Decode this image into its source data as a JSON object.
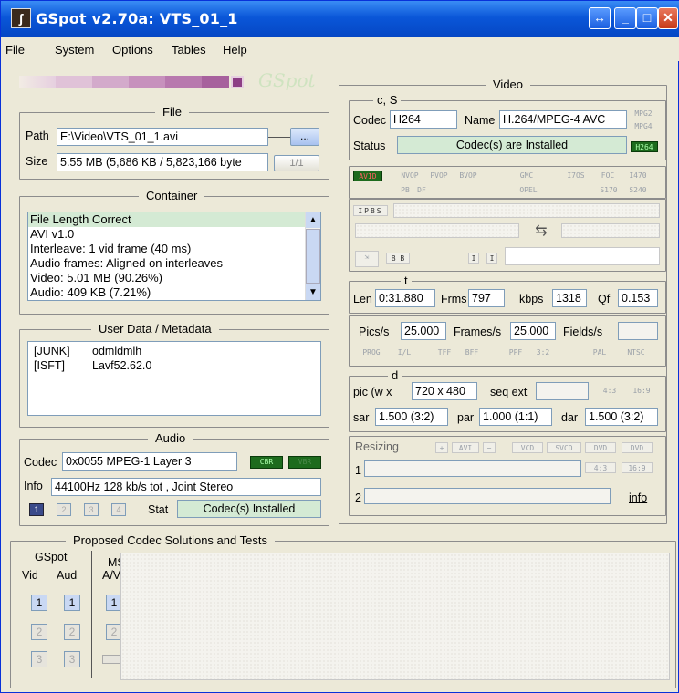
{
  "window": {
    "title": "GSpot v2.70a: VTS_01_1"
  },
  "menu": [
    "File",
    "System",
    "Options",
    "Tables",
    "Help"
  ],
  "file": {
    "group_title": "File",
    "path_label": "Path",
    "path_value": "E:\\Video\\VTS_01_1.avi",
    "browse_label": "...",
    "size_label": "Size",
    "size_value": "5.55 MB (5,686 KB / 5,823,166 byte",
    "counter": "1/1"
  },
  "container": {
    "group_title": "Container",
    "items": [
      "File Length Correct",
      "AVI v1.0",
      "Interleave: 1 vid frame (40 ms)",
      "Audio frames: Aligned on interleaves",
      "Video: 5.01 MB (90.26%)",
      "Audio: 409 KB (7.21%)"
    ]
  },
  "user_data": {
    "group_title": "User Data / Metadata",
    "rows": [
      {
        "key": "[JUNK]",
        "value": "odmldmlh"
      },
      {
        "key": "[ISFT]",
        "value": "Lavf52.62.0"
      }
    ]
  },
  "audio": {
    "group_title": "Audio",
    "codec_label": "Codec",
    "codec_value": "0x0055 MPEG-1 Layer 3",
    "cbr": "CBR",
    "vbr": "VBR",
    "info_label": "Info",
    "info_value": "44100Hz  128 kb/s tot , Joint Stereo",
    "streams": [
      "1",
      "2",
      "3",
      "4"
    ],
    "stat_label": "Stat",
    "stat_value": "Codec(s) Installed"
  },
  "video": {
    "group_title": "Video",
    "cs_title": "c, S",
    "codec_label": "Codec",
    "codec_value": "H264",
    "name_label": "Name",
    "name_value": "H.264/MPEG-4 AVC",
    "mpeg_tags": [
      "MPG2",
      "MPG4",
      "H264"
    ],
    "status_label": "Status",
    "status_value": "Codec(s) are Installed",
    "flags": [
      "AVID",
      "NVOP",
      "PVOP",
      "BVOP",
      "GMC",
      "I7OS",
      "FOC",
      "I470",
      "PB",
      "DF",
      "OPEL",
      "S170",
      "S240"
    ],
    "ipbs": "IPBS",
    "t_title": "t",
    "len_label": "Len",
    "len_value": "0:31.880",
    "frms_label": "Frms",
    "frms_value": "797",
    "kbps_label": "kbps",
    "kbps_value": "1318",
    "qf_label": "Qf",
    "qf_value": "0.153",
    "pics_label": "Pics/s",
    "pics_value": "25.000",
    "frames_label": "Frames/s",
    "frames_value": "25.000",
    "fields_label": "Fields/s",
    "fields_value": "",
    "scan_tags": [
      "PROG",
      "I/L",
      "TFF",
      "BFF",
      "PPF",
      "3:2",
      "PAL",
      "NTSC"
    ],
    "d_title": "d",
    "pic_label": "pic (w x",
    "pic_value": "720 x 480",
    "seqext_label": "seq ext",
    "aspect_tags": [
      "4:3",
      "16:9"
    ],
    "sar_label": "sar",
    "sar_value": "1.500 (3:2)",
    "par_label": "par",
    "par_value": "1.000 (1:1)",
    "dar_label": "dar",
    "dar_value": "1.500 (3:2)",
    "resizing_label": "Resizing",
    "resize_tags": [
      "+",
      "AVI",
      "−",
      "VCD",
      "SVCD",
      "DVD",
      "DVD"
    ],
    "resize_aspect": [
      "4:3",
      "16:9"
    ],
    "row1_label": "1",
    "row2_label": "2",
    "info_link": "info"
  },
  "proposed": {
    "group_title": "Proposed Codec Solutions and Tests",
    "gspot_label": "GSpot",
    "vid_label": "Vid",
    "aud_label": "Aud",
    "ms_label": "MS",
    "av_label": "A/V",
    "buttons": [
      "1",
      "2",
      "3"
    ]
  },
  "colors": {
    "titlebar": "#0a56d8",
    "panel": "#ece9d8",
    "accent_green": "#1d6b1d",
    "selected": "#3a4a8a"
  }
}
